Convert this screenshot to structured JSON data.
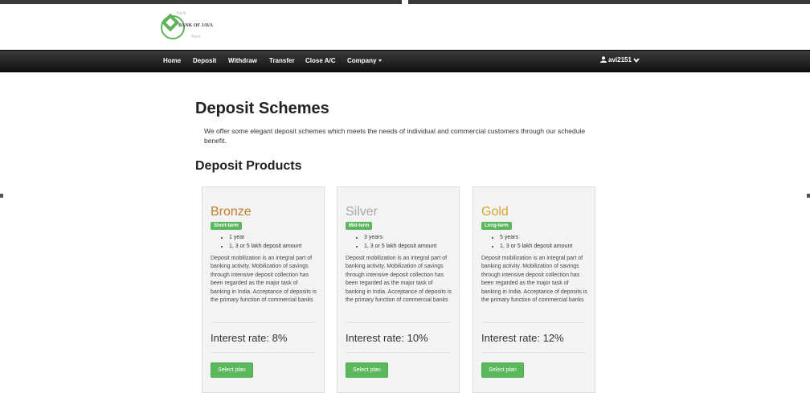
{
  "brand": {
    "name": "BANK OF JAVA",
    "colors": {
      "green": "#5cb85c",
      "logo": "#5db35a",
      "navbar": "#1e1e1e"
    }
  },
  "nav": {
    "items": [
      "Home",
      "Deposit",
      "Withdraw",
      "Transfer",
      "Close A/C",
      "Company"
    ],
    "user": "avi2151"
  },
  "page": {
    "title": "Deposit Schemes",
    "intro": "We offer some elegant deposit schemes which meets the needs of individual and commercial customers through our schedule benefit.",
    "products_heading": "Deposit Products"
  },
  "plans": [
    {
      "name": "Bronze",
      "color": "#c27c2c",
      "badge": "Short-term",
      "features": [
        "1 year",
        "1, 3 or 5 lakh deposit amount"
      ],
      "description": "Deposit mobilization is an integral part of banking activity. Mobilization of savings through intensive deposit collection has been regarded as the major task of banking in India. Acceptance of deposits is the primary function of commercial banks",
      "rate": "Interest rate: 8%",
      "button": "Select plan"
    },
    {
      "name": "Silver",
      "color": "#a8a8a8",
      "badge": "Mid-term",
      "features": [
        "3 years",
        "1, 3 or 5 lakh deposit amount"
      ],
      "description": "Deposit mobilization is an integral part of banking activity. Mobilization of savings through intensive deposit collection has been regarded as the major task of banking in India. Acceptance of deposits is the primary function of commercial banks",
      "rate": "Interest rate: 10%",
      "button": "Select plan"
    },
    {
      "name": "Gold",
      "color": "#d4a82a",
      "badge": "Long-term",
      "features": [
        "5 years",
        "1, 3 or 5 lakh deposit amount"
      ],
      "description": "Deposit mobilization is an integral part of banking activity. Mobilization of savings through intensive deposit collection has been regarded as the major task of banking in India. Acceptance of deposits is the primary function of commercial banks",
      "rate": "Interest rate: 12%",
      "button": "Select plan"
    }
  ]
}
